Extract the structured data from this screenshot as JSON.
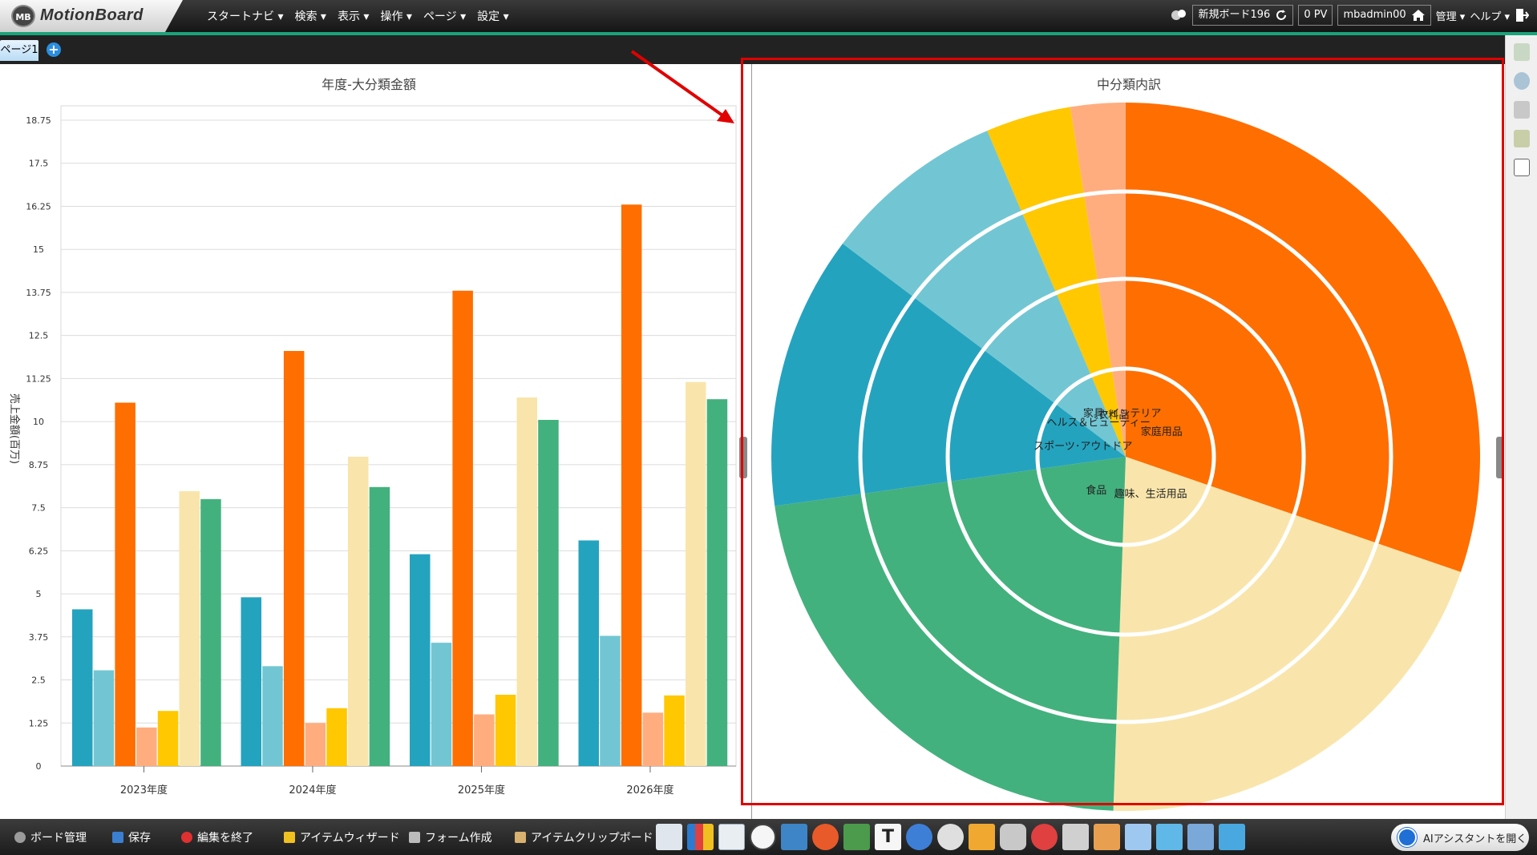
{
  "app": {
    "badge": "MB",
    "logo": "MotionBoard"
  },
  "topmenu": [
    "スタートナビ ▾",
    "検索 ▾",
    "表示 ▾",
    "操作 ▾",
    "ページ ▾",
    "設定 ▾"
  ],
  "topright": {
    "board": "新規ボード196",
    "pv": "0 PV",
    "user": "mbadmin00",
    "admin": "管理 ▾",
    "help": "ヘルプ ▾"
  },
  "tabs": {
    "active": "ページ1"
  },
  "left_panel": {
    "title": "年度-大分類金額"
  },
  "right_panel": {
    "title": "中分類内訳"
  },
  "bottombar": {
    "items": [
      "ボード管理",
      "保存",
      "編集を終了",
      "アイテムウィザード",
      "フォーム作成",
      "アイテムクリップボード"
    ],
    "ai_button": "AIアシスタントを開く"
  },
  "chart_data": [
    {
      "type": "bar",
      "title": "年度-大分類金額",
      "ylabel": "売上金額(百万)",
      "xlabel": "",
      "ylim": [
        0,
        18.75
      ],
      "yticks": [
        "0",
        "1.25",
        "2.5",
        "3.75",
        "5",
        "6.25",
        "7.5",
        "8.75",
        "10",
        "11.25",
        "12.5",
        "13.75",
        "15",
        "16.25",
        "17.5",
        "18.75"
      ],
      "categories": [
        "2023年度",
        "2024年度",
        "2025年度",
        "2026年度"
      ],
      "series": [
        {
          "color": "#24a3bf",
          "values": [
            4.55,
            4.9,
            6.15,
            6.55
          ]
        },
        {
          "color": "#72c6d3",
          "values": [
            2.78,
            2.9,
            3.58,
            3.78
          ]
        },
        {
          "color": "#ff6e00",
          "values": [
            10.55,
            12.05,
            13.8,
            16.3
          ]
        },
        {
          "color": "#ffad7f",
          "values": [
            1.12,
            1.25,
            1.5,
            1.55
          ]
        },
        {
          "color": "#ffc800",
          "values": [
            1.6,
            1.68,
            2.07,
            2.05
          ]
        },
        {
          "color": "#f9e5ab",
          "values": [
            7.98,
            8.98,
            10.7,
            11.15
          ]
        },
        {
          "color": "#43b17e",
          "values": [
            7.75,
            8.1,
            10.05,
            10.65
          ]
        }
      ]
    },
    {
      "type": "pie",
      "title": "中分類内訳",
      "rings": 3,
      "slices": [
        {
          "label": "家庭用品",
          "color": "#ff6e00",
          "start": 0,
          "end": 109
        },
        {
          "label": "趣味、生活用品",
          "color": "#f9e5ab",
          "start": 109,
          "end": 182
        },
        {
          "label": "食品",
          "color": "#43b17e",
          "start": 182,
          "end": 262
        },
        {
          "label": "スポーツ･アウトドア",
          "color": "#24a3bf",
          "start": 262,
          "end": 307
        },
        {
          "label": "ヘルス＆ビューティー",
          "color": "#72c6d3",
          "start": 307,
          "end": 337
        },
        {
          "label": "衣料品",
          "color": "#ffc800",
          "start": 337,
          "end": 351
        },
        {
          "label": "家具･インテリア",
          "color": "#ffad7f",
          "start": 351,
          "end": 360
        }
      ]
    }
  ]
}
